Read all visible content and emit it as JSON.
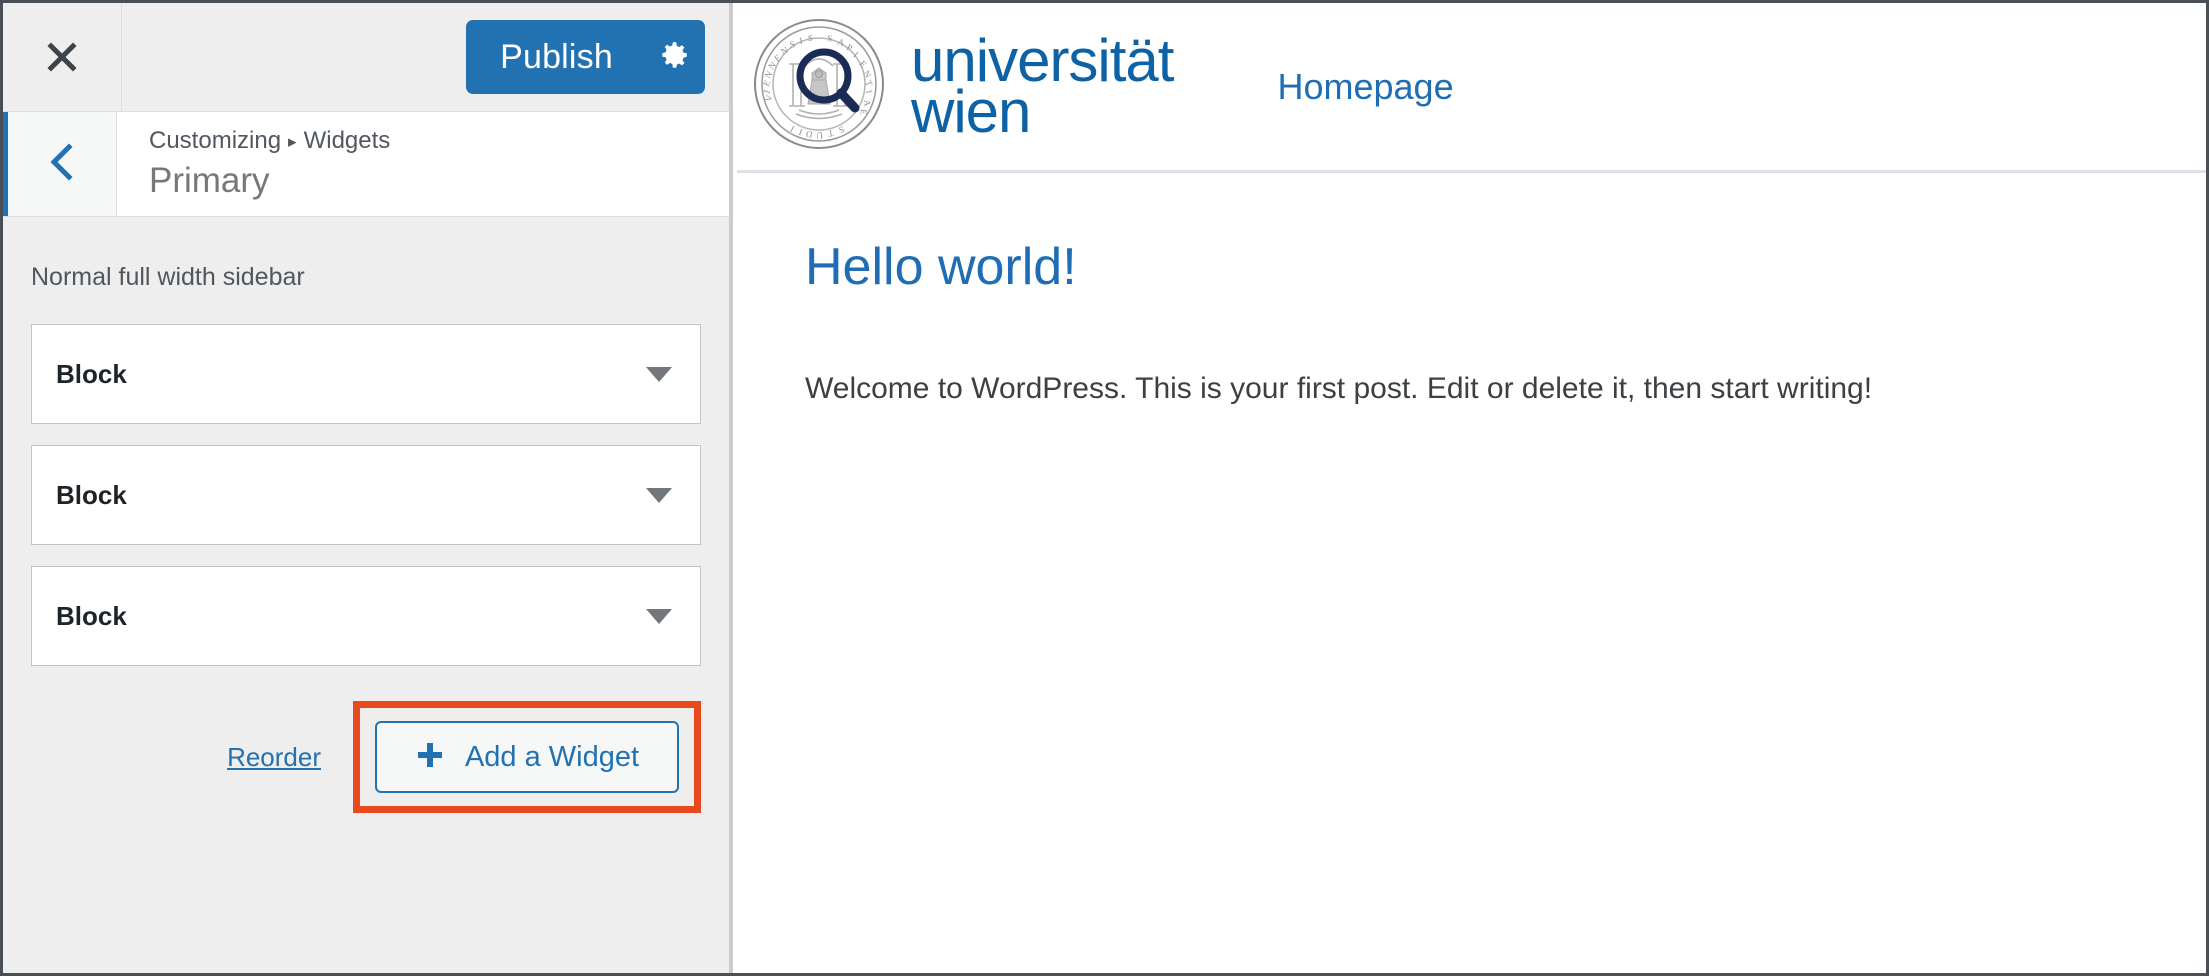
{
  "customizer": {
    "close_label": "Close",
    "publish_label": "Publish",
    "gear_label": "Publish Settings",
    "back_label": "Back",
    "breadcrumb": {
      "root": "Customizing",
      "separator": "▸",
      "current": "Widgets"
    },
    "panel_title": "Primary",
    "sidebar_description": "Normal full width sidebar",
    "widgets": [
      {
        "title": "Block",
        "caret": "chevron-down-icon"
      },
      {
        "title": "Block",
        "caret": "chevron-down-icon"
      },
      {
        "title": "Block",
        "caret": "chevron-down-icon"
      }
    ],
    "reorder_label": "Reorder",
    "add_widget_label": "Add a Widget",
    "add_widget_icon": "plus-icon",
    "highlight_color": "#e8491d",
    "accent_color": "#2271b1"
  },
  "preview": {
    "logo_alt": "universitat wien seal",
    "wordmark_line1": "universität",
    "wordmark_line2": "wien",
    "nav": [
      {
        "label": "Homepage"
      }
    ],
    "post": {
      "title": "Hello world!",
      "body": "Welcome to WordPress. This is your first post. Edit or delete it, then start writing!"
    },
    "brand_color": "#0d62a6",
    "link_color": "#1f6db4"
  }
}
